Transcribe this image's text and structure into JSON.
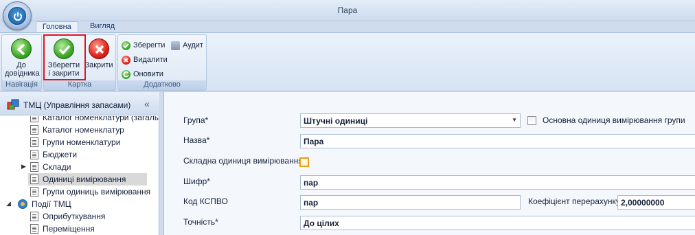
{
  "window": {
    "title": "Пара"
  },
  "tabs": [
    {
      "label": "Головна",
      "active": true
    },
    {
      "label": "Вигляд",
      "active": false
    }
  ],
  "ribbon": {
    "groups": {
      "navigation": "Навігація",
      "card": "Картка",
      "extra": "Додатково"
    },
    "buttons": {
      "back_line1": "До",
      "back_line2": "довідника",
      "save_close_line1": "Зберегти",
      "save_close_line2": "і закрити",
      "close": "Закрити",
      "save": "Зберегти",
      "audit": "Аудит",
      "delete": "Видалити",
      "refresh": "Оновити"
    }
  },
  "nav": {
    "title": "ТМЦ (Управління запасами)",
    "items": [
      {
        "label": "Каталог номенклатури (загальн",
        "selected": false
      },
      {
        "label": "Каталог номенклатур",
        "selected": false
      },
      {
        "label": "Групи номенклатури",
        "selected": false
      },
      {
        "label": "Бюджети",
        "selected": false
      },
      {
        "label": "Склади",
        "selected": false
      },
      {
        "label": "Одиниці вимірювання",
        "selected": true
      },
      {
        "label": "Групи одиниць вимірювання",
        "selected": false
      },
      {
        "label": "Події ТМЦ",
        "selected": false
      },
      {
        "label": "Оприбуткування",
        "selected": false
      },
      {
        "label": "Переміщення",
        "selected": false
      }
    ]
  },
  "form": {
    "group_label": "Група*",
    "group_value": "Штучні одиниці",
    "main_unit_label": "Основна одиниця вимірювання групи",
    "name_label": "Назва*",
    "name_value": "Пара",
    "composite_label": "Складна одиниця вимірювання",
    "code_label": "Шифр*",
    "code_value": "пар",
    "kspvo_label": "Код КСПВО",
    "kspvo_value": "пар",
    "coef_label": "Коефіцієнт перерахунку",
    "coef_value": "2,00000000",
    "precision_label": "Точність*",
    "precision_value": "До цілих"
  },
  "colors": {
    "accent": "#e0161c",
    "ribbon_bg": "#dde8f5",
    "selected_row": "#d9d9d9"
  }
}
